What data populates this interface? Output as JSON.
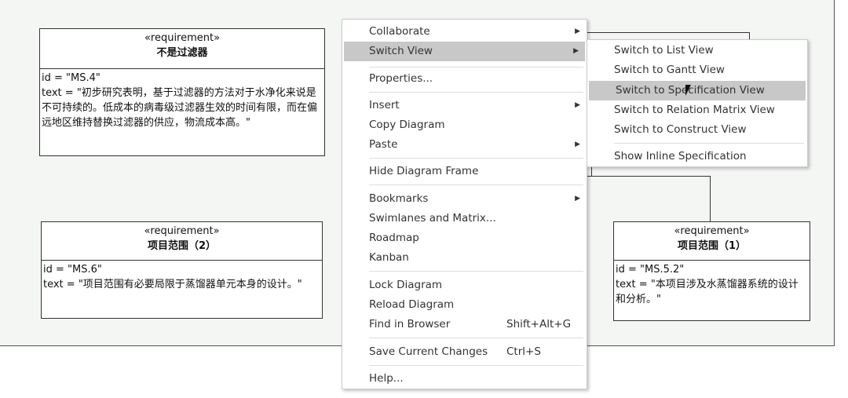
{
  "diagram": {
    "requirements": [
      {
        "stereotype": "«requirement»",
        "name": "不是过滤器",
        "id_line": "id = \"MS.4\"",
        "text_line": "text = \"初步研究表明，基于过滤器的方法对于水净化来说是不可持续的。低成本的病毒级过滤器生效的时间有限，而在偏远地区维持替换过滤器的供应，物流成本高。\""
      },
      {
        "stereotype": "«requirement»",
        "name": "项目范围（2）",
        "id_line": "id = \"MS.6\"",
        "text_line": "text = \"项目范围有必要局限于蒸馏器单元本身的设计。\""
      },
      {
        "stereotype": "«requirement»",
        "name": "项目范围（1）",
        "id_line": "id = \"MS.5.2\"",
        "text_line": "text = \"本项目涉及水蒸馏器系统的设计和分析。\""
      }
    ]
  },
  "context_menu": {
    "items": [
      {
        "label": "Collaborate",
        "submenu": true
      },
      {
        "label": "Switch View",
        "submenu": true,
        "highlighted": true
      },
      {
        "label": "Properties..."
      },
      {
        "label": "Insert",
        "submenu": true
      },
      {
        "label": "Copy Diagram"
      },
      {
        "label": "Paste",
        "submenu": true
      },
      {
        "label": "Hide Diagram Frame"
      },
      {
        "label": "Bookmarks",
        "submenu": true
      },
      {
        "label": "Swimlanes and Matrix..."
      },
      {
        "label": "Roadmap"
      },
      {
        "label": "Kanban"
      },
      {
        "label": "Lock Diagram"
      },
      {
        "label": "Reload Diagram"
      },
      {
        "label": "Find in Browser",
        "shortcut": "Shift+Alt+G"
      },
      {
        "label": "Save Current Changes",
        "shortcut": "Ctrl+S"
      },
      {
        "label": "Help..."
      }
    ],
    "arrow": "▶"
  },
  "submenu": {
    "items": [
      {
        "label": "Switch to List View"
      },
      {
        "label": "Switch to Gantt View"
      },
      {
        "label": "Switch to Specification View",
        "highlighted": true
      },
      {
        "label": "Switch to Relation Matrix View"
      },
      {
        "label": "Switch to Construct View"
      },
      {
        "label": "Show Inline Specification"
      }
    ]
  }
}
